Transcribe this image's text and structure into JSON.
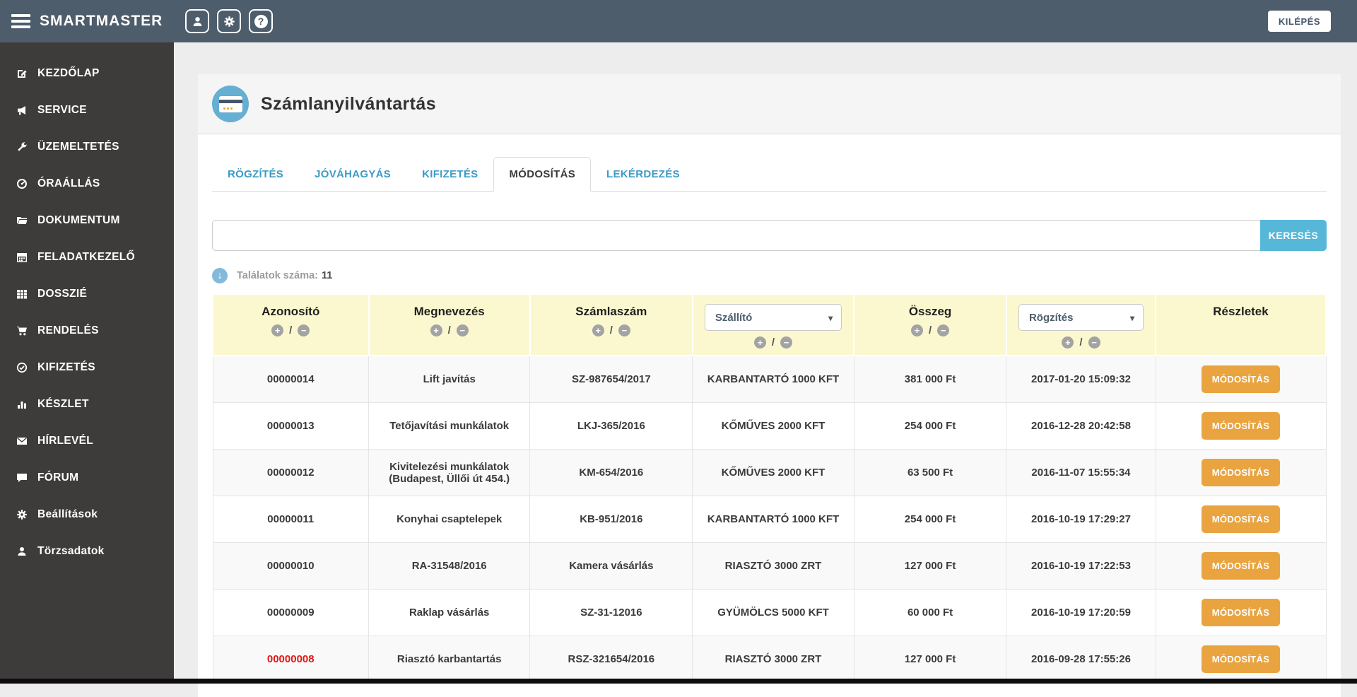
{
  "colors": {
    "topbar_bg": "#4e5d6c",
    "sidebar_bg": "#3e3c3b",
    "accent_blue": "#57b7d8",
    "tab_link_blue": "#3d9bc7",
    "table_header_yellow": "#fbf8cf",
    "action_orange": "#e9a440",
    "highlight_red": "#e11818"
  },
  "topbar": {
    "brand": "SMARTMASTER",
    "logout_label": "KILÉPÉS",
    "icons": [
      "menu-icon",
      "user-icon",
      "gear-icon",
      "help-icon"
    ]
  },
  "sidebar": {
    "items": [
      {
        "label": "KEZDŐLAP",
        "icon": "edit-icon"
      },
      {
        "label": "SERVICE",
        "icon": "megaphone-icon"
      },
      {
        "label": "ÜZEMELTETÉS",
        "icon": "wrench-icon"
      },
      {
        "label": "ÓRAÁLLÁS",
        "icon": "gauge-icon"
      },
      {
        "label": "DOKUMENTUM",
        "icon": "folder-icon"
      },
      {
        "label": "FELADATKEZELŐ",
        "icon": "calendar-icon"
      },
      {
        "label": "DOSSZIÉ",
        "icon": "grid-icon"
      },
      {
        "label": "RENDELÉS",
        "icon": "cart-icon"
      },
      {
        "label": "KIFIZETÉS",
        "icon": "check-circle-icon"
      },
      {
        "label": "KÉSZLET",
        "icon": "bar-chart-icon"
      },
      {
        "label": "HÍRLEVÉL",
        "icon": "envelope-icon"
      },
      {
        "label": "FÓRUM",
        "icon": "comment-icon"
      },
      {
        "label": "Beállítások",
        "icon": "gear-icon"
      },
      {
        "label": "Törzsadatok",
        "icon": "user-icon"
      }
    ]
  },
  "page": {
    "title": "Számlanyilvántartás",
    "tabs": [
      {
        "label": "RÖGZÍTÉS",
        "active": false
      },
      {
        "label": "JÓVÁHAGYÁS",
        "active": false
      },
      {
        "label": "KIFIZETÉS",
        "active": false
      },
      {
        "label": "MÓDOSÍTÁS",
        "active": true
      },
      {
        "label": "LEKÉRDEZÉS",
        "active": false
      }
    ],
    "search": {
      "value": "",
      "button_label": "KERESÉS"
    },
    "results_label": "Találatok száma:",
    "results_count": "11"
  },
  "table": {
    "columns": [
      {
        "label": "Azonosító",
        "sortable": true,
        "type": "text"
      },
      {
        "label": "Megnevezés",
        "sortable": true,
        "type": "text"
      },
      {
        "label": "Számlaszám",
        "sortable": true,
        "type": "text"
      },
      {
        "label": "Szállító",
        "sortable": true,
        "type": "select"
      },
      {
        "label": "Összeg",
        "sortable": true,
        "type": "text"
      },
      {
        "label": "Rögzítés",
        "sortable": true,
        "type": "select"
      },
      {
        "label": "Részletek",
        "sortable": false,
        "type": "text"
      }
    ],
    "action_label": "MÓDOSÍTÁS",
    "rows": [
      {
        "id": "00000014",
        "name": "Lift javítás",
        "invoice": "SZ-987654/2017",
        "supplier": "KARBANTARTÓ 1000 KFT",
        "amount": "381 000 Ft",
        "recorded": "2017-01-20 15:09:32",
        "highlight": false
      },
      {
        "id": "00000013",
        "name": "Tetőjavítási munkálatok",
        "invoice": "LKJ-365/2016",
        "supplier": "KŐMŰVES 2000 KFT",
        "amount": "254 000 Ft",
        "recorded": "2016-12-28 20:42:58",
        "highlight": false
      },
      {
        "id": "00000012",
        "name": "Kivitelezési munkálatok (Budapest, Üllői út 454.)",
        "invoice": "KM-654/2016",
        "supplier": "KŐMŰVES 2000 KFT",
        "amount": "63 500 Ft",
        "recorded": "2016-11-07 15:55:34",
        "highlight": false
      },
      {
        "id": "00000011",
        "name": "Konyhai csaptelepek",
        "invoice": "KB-951/2016",
        "supplier": "KARBANTARTÓ 1000 KFT",
        "amount": "254 000 Ft",
        "recorded": "2016-10-19 17:29:27",
        "highlight": false
      },
      {
        "id": "00000010",
        "name": "RA-31548/2016",
        "invoice": "Kamera vásárlás",
        "supplier": "RIASZTÓ 3000 ZRT",
        "amount": "127 000 Ft",
        "recorded": "2016-10-19 17:22:53",
        "highlight": false
      },
      {
        "id": "00000009",
        "name": "Raklap vásárlás",
        "invoice": "SZ-31-12016",
        "supplier": "GYÜMÖLCS 5000 KFT",
        "amount": "60 000 Ft",
        "recorded": "2016-10-19 17:20:59",
        "highlight": false
      },
      {
        "id": "00000008",
        "name": "Riasztó karbantartás",
        "invoice": "RSZ-321654/2016",
        "supplier": "RIASZTÓ 3000 ZRT",
        "amount": "127 000 Ft",
        "recorded": "2016-09-28 17:55:26",
        "highlight": true
      }
    ]
  }
}
